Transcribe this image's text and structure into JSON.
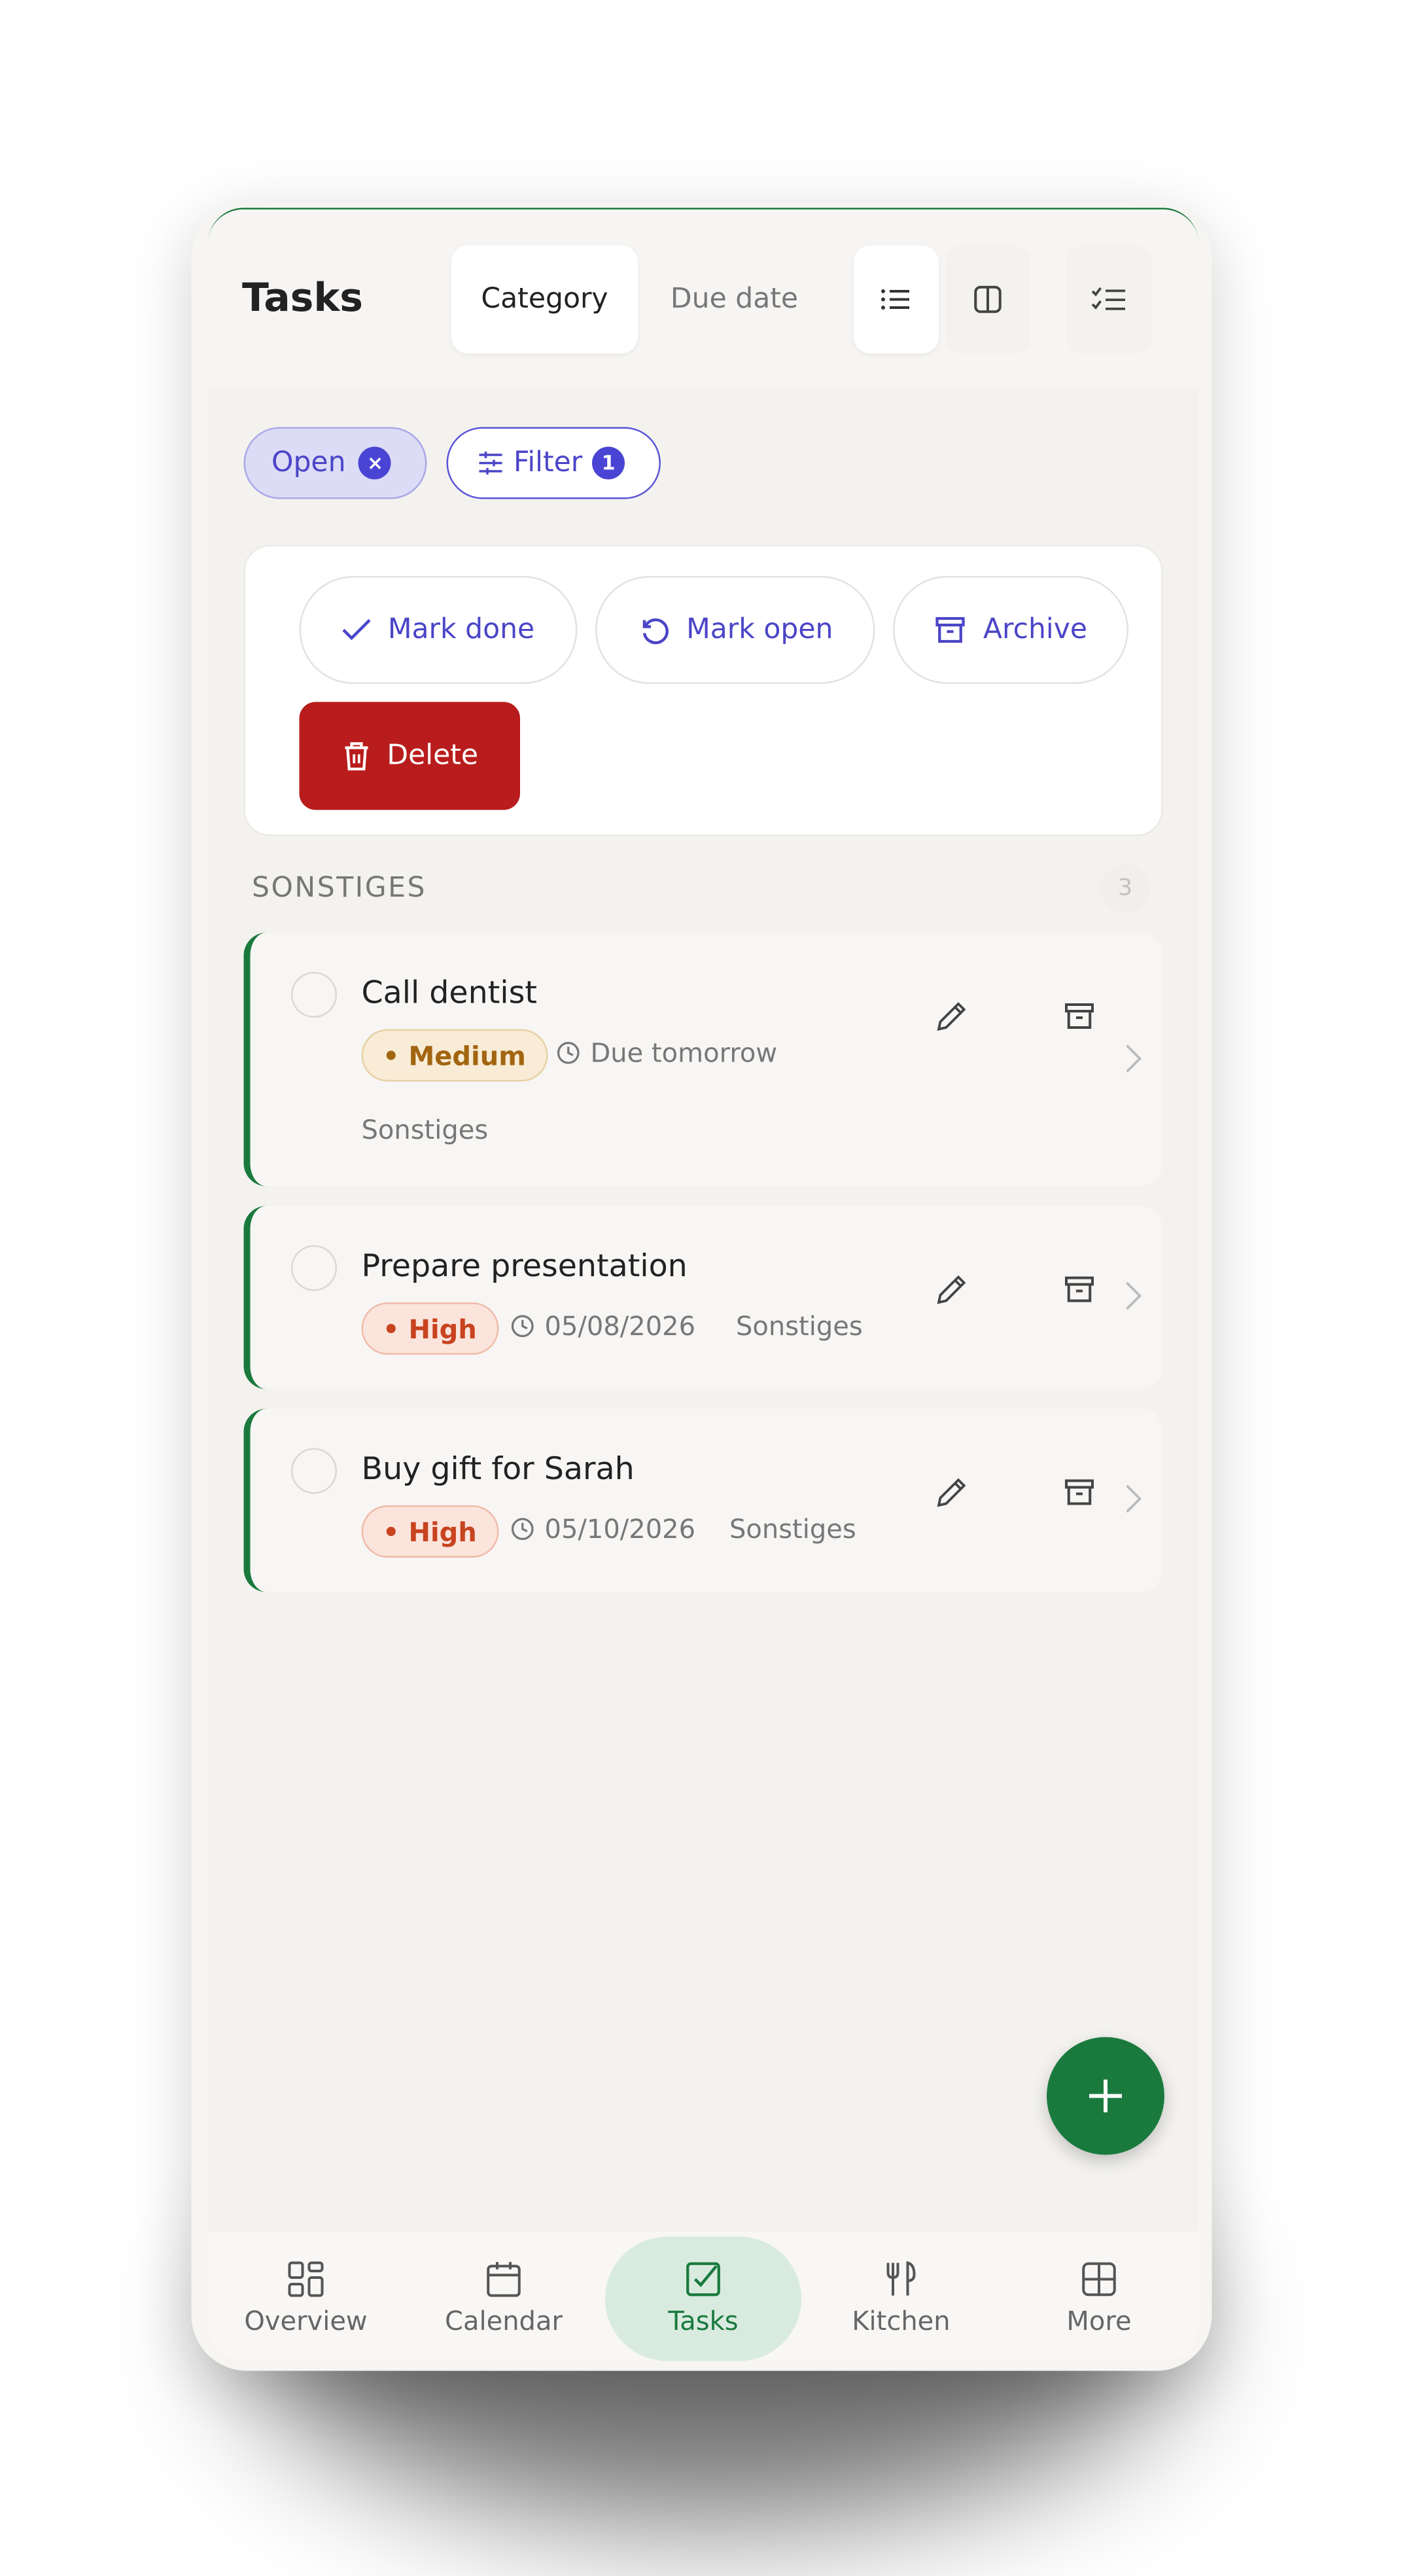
{
  "header": {
    "title": "Tasks",
    "group_tabs": [
      {
        "label": "Category",
        "active": true
      },
      {
        "label": "Due date",
        "active": false
      }
    ],
    "view_icons": [
      "list-view-icon",
      "board-view-icon"
    ],
    "select_icon": "checklist-icon"
  },
  "filters": {
    "status_chip": "Open",
    "status_chip_remove": "×",
    "filter_label": "Filter",
    "filter_count": "1"
  },
  "bulk_actions": {
    "mark_done": "Mark done",
    "mark_open": "Mark open",
    "archive": "Archive",
    "delete": "Delete"
  },
  "section": {
    "title": "SONSTIGES",
    "count": "3"
  },
  "tasks": [
    {
      "title": "Call dentist",
      "priority": "• Medium",
      "priority_level": "medium",
      "due": "Due tomorrow",
      "category": "Sonstiges"
    },
    {
      "title": "Prepare presentation",
      "priority": "• High",
      "priority_level": "high",
      "due": "05/08/2026",
      "category": "Sonstiges"
    },
    {
      "title": "Buy gift for Sarah",
      "priority": "• High",
      "priority_level": "high",
      "due": "05/10/2026",
      "category": "Sonstiges"
    }
  ],
  "fab_label": "+",
  "nav": [
    {
      "label": "Overview",
      "icon": "overview-icon",
      "active": false
    },
    {
      "label": "Calendar",
      "icon": "calendar-icon",
      "active": false
    },
    {
      "label": "Tasks",
      "icon": "tasks-icon",
      "active": true
    },
    {
      "label": "Kitchen",
      "icon": "kitchen-icon",
      "active": false
    },
    {
      "label": "More",
      "icon": "more-icon",
      "active": false
    }
  ],
  "colors": {
    "accent_green": "#1a7a3e",
    "indigo": "#4b45c8",
    "danger": "#b91c1c"
  }
}
